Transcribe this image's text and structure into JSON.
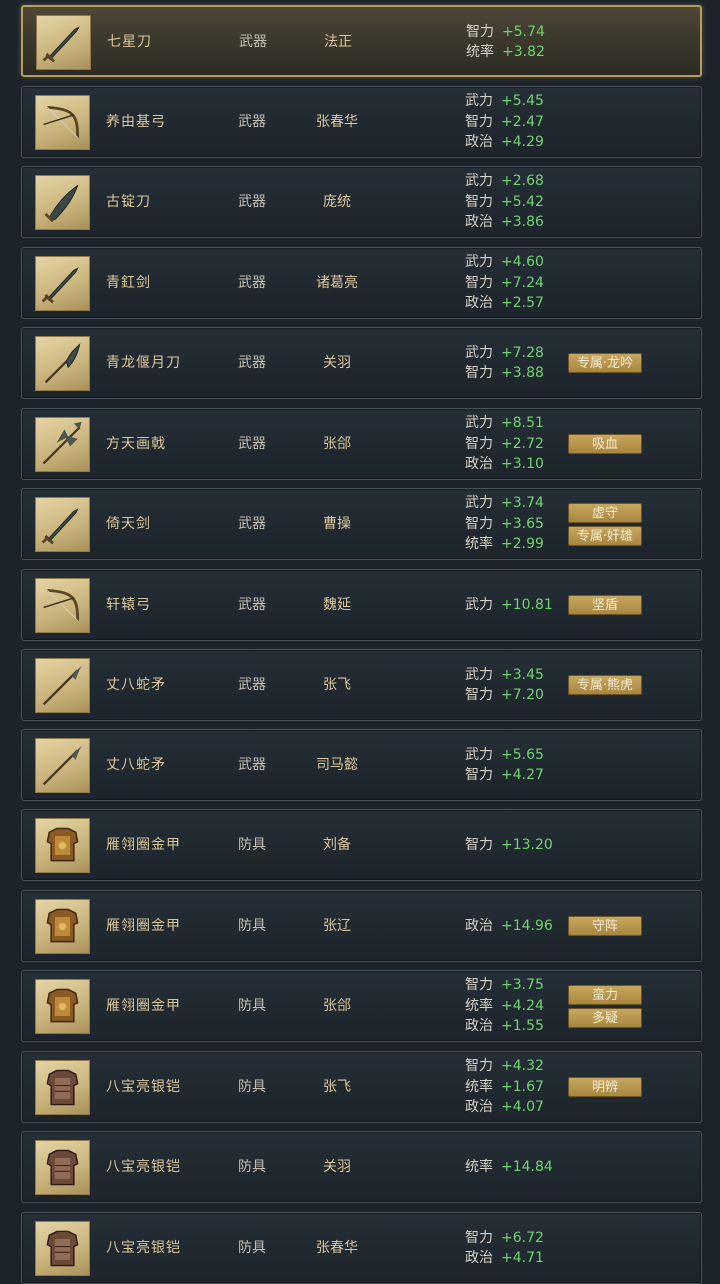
{
  "colors": {
    "accent": "#dcc79a",
    "stat_value": "#6fd46f",
    "skill_bg": "#b8964e"
  },
  "rows": [
    {
      "name": "七星刀",
      "type": "武器",
      "general": "法正",
      "icon": "sword-icon",
      "stats": [
        {
          "k": "智力",
          "v": "+5.74"
        },
        {
          "k": "统率",
          "v": "+3.82"
        }
      ],
      "skills": [],
      "selected": true
    },
    {
      "name": "养由基弓",
      "type": "武器",
      "general": "张春华",
      "icon": "bow-icon",
      "stats": [
        {
          "k": "武力",
          "v": "+5.45"
        },
        {
          "k": "智力",
          "v": "+2.47"
        },
        {
          "k": "政治",
          "v": "+4.29"
        }
      ],
      "skills": []
    },
    {
      "name": "古锭刀",
      "type": "武器",
      "general": "庞统",
      "icon": "blade-icon",
      "stats": [
        {
          "k": "武力",
          "v": "+2.68"
        },
        {
          "k": "智力",
          "v": "+5.42"
        },
        {
          "k": "政治",
          "v": "+3.86"
        }
      ],
      "skills": []
    },
    {
      "name": "青釭剑",
      "type": "武器",
      "general": "诸葛亮",
      "icon": "sword-icon",
      "stats": [
        {
          "k": "武力",
          "v": "+4.60"
        },
        {
          "k": "智力",
          "v": "+7.24"
        },
        {
          "k": "政治",
          "v": "+2.57"
        }
      ],
      "skills": []
    },
    {
      "name": "青龙偃月刀",
      "type": "武器",
      "general": "关羽",
      "icon": "glaive-icon",
      "stats": [
        {
          "k": "武力",
          "v": "+7.28"
        },
        {
          "k": "智力",
          "v": "+3.88"
        }
      ],
      "skills": [
        "专属·龙吟"
      ]
    },
    {
      "name": "方天画戟",
      "type": "武器",
      "general": "张郃",
      "icon": "halberd-icon",
      "stats": [
        {
          "k": "武力",
          "v": "+8.51"
        },
        {
          "k": "智力",
          "v": "+2.72"
        },
        {
          "k": "政治",
          "v": "+3.10"
        }
      ],
      "skills": [
        "吸血"
      ]
    },
    {
      "name": "倚天剑",
      "type": "武器",
      "general": "曹操",
      "icon": "sword-icon",
      "stats": [
        {
          "k": "武力",
          "v": "+3.74"
        },
        {
          "k": "智力",
          "v": "+3.65"
        },
        {
          "k": "统率",
          "v": "+2.99"
        }
      ],
      "skills": [
        "虚守",
        "专属·奸雄"
      ]
    },
    {
      "name": "轩辕弓",
      "type": "武器",
      "general": "魏延",
      "icon": "bow-icon",
      "stats": [
        {
          "k": "武力",
          "v": "+10.81"
        }
      ],
      "skills": [
        "坚盾"
      ]
    },
    {
      "name": "丈八蛇矛",
      "type": "武器",
      "general": "张飞",
      "icon": "spear-icon",
      "stats": [
        {
          "k": "武力",
          "v": "+3.45"
        },
        {
          "k": "智力",
          "v": "+7.20"
        }
      ],
      "skills": [
        "专属·熊虎"
      ]
    },
    {
      "name": "丈八蛇矛",
      "type": "武器",
      "general": "司马懿",
      "icon": "spear-icon",
      "stats": [
        {
          "k": "武力",
          "v": "+5.65"
        },
        {
          "k": "智力",
          "v": "+4.27"
        }
      ],
      "skills": []
    },
    {
      "name": "雁翎圈金甲",
      "type": "防具",
      "general": "刘备",
      "icon": "gold-armor-icon",
      "stats": [
        {
          "k": "智力",
          "v": "+13.20"
        }
      ],
      "skills": []
    },
    {
      "name": "雁翎圈金甲",
      "type": "防具",
      "general": "张辽",
      "icon": "gold-armor-icon",
      "stats": [
        {
          "k": "政治",
          "v": "+14.96"
        }
      ],
      "skills": [
        "守阵"
      ]
    },
    {
      "name": "雁翎圈金甲",
      "type": "防具",
      "general": "张郃",
      "icon": "gold-armor-icon",
      "stats": [
        {
          "k": "智力",
          "v": "+3.75"
        },
        {
          "k": "统率",
          "v": "+4.24"
        },
        {
          "k": "政治",
          "v": "+1.55"
        }
      ],
      "skills": [
        "蛮力",
        "多疑"
      ]
    },
    {
      "name": "八宝亮银铠",
      "type": "防具",
      "general": "张飞",
      "icon": "silver-armor-icon",
      "stats": [
        {
          "k": "智力",
          "v": "+4.32"
        },
        {
          "k": "统率",
          "v": "+1.67"
        },
        {
          "k": "政治",
          "v": "+4.07"
        }
      ],
      "skills": [
        "明辨"
      ]
    },
    {
      "name": "八宝亮银铠",
      "type": "防具",
      "general": "关羽",
      "icon": "silver-armor-icon",
      "stats": [
        {
          "k": "统率",
          "v": "+14.84"
        }
      ],
      "skills": []
    },
    {
      "name": "八宝亮银铠",
      "type": "防具",
      "general": "张春华",
      "icon": "silver-armor-icon",
      "stats": [
        {
          "k": "智力",
          "v": "+6.72"
        },
        {
          "k": "政治",
          "v": "+4.71"
        }
      ],
      "skills": []
    }
  ]
}
